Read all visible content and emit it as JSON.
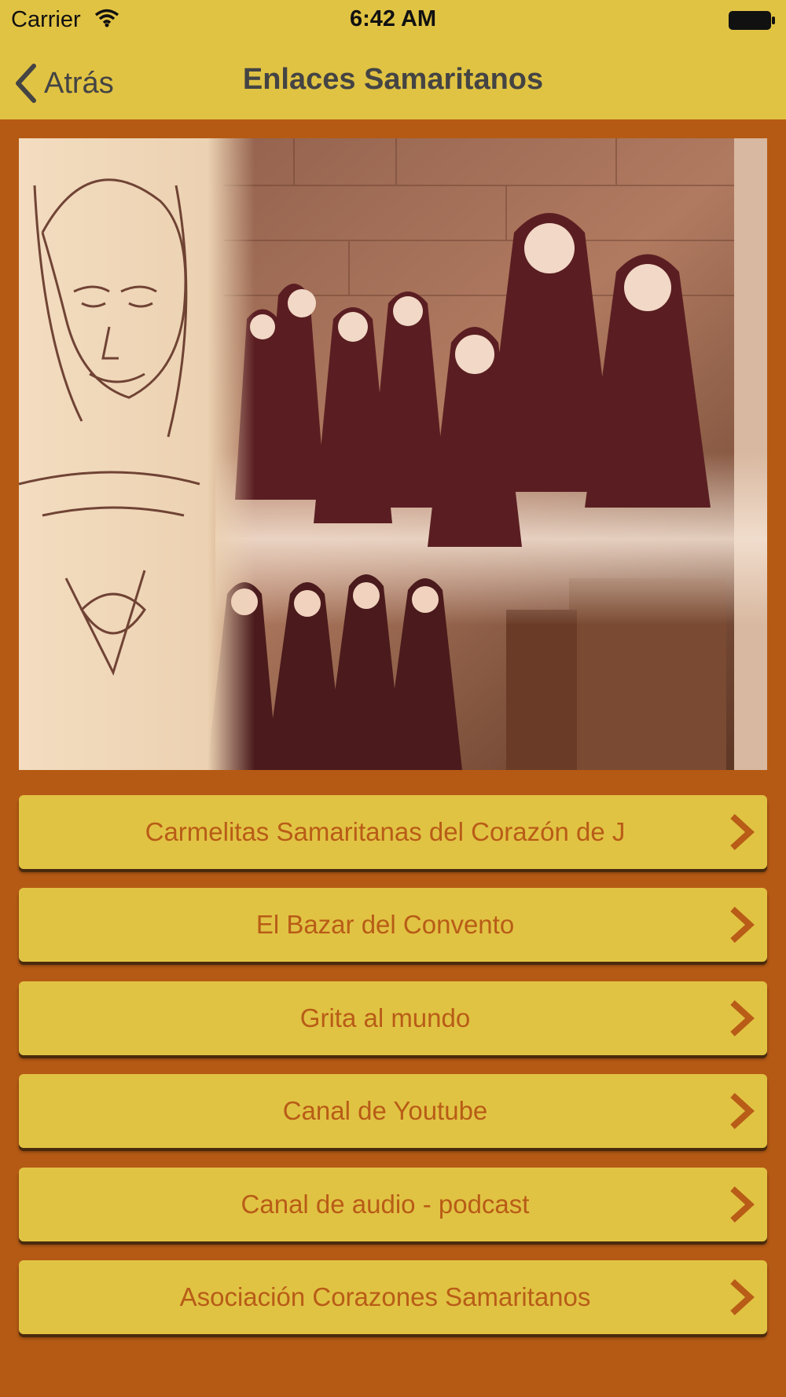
{
  "status_bar": {
    "carrier": "Carrier",
    "time": "6:42 AM"
  },
  "nav": {
    "back_label": "Atrás",
    "title": "Enlaces Samaritanos"
  },
  "colors": {
    "bar": "#e1c343",
    "background": "#b55a14",
    "button_text": "#b85c17",
    "nav_text": "#444444"
  },
  "links": [
    {
      "label": "Carmelitas Samaritanas del Corazón de J",
      "icon": "chevron-right-icon"
    },
    {
      "label": "El Bazar del Convento",
      "icon": "chevron-right-icon"
    },
    {
      "label": "Grita al mundo",
      "icon": "chevron-right-icon"
    },
    {
      "label": "Canal de Youtube",
      "icon": "chevron-right-icon"
    },
    {
      "label": "Canal de audio - podcast",
      "icon": "chevron-right-icon"
    },
    {
      "label": "Asociación Corazones Samaritanos",
      "icon": "chevron-right-icon"
    }
  ]
}
